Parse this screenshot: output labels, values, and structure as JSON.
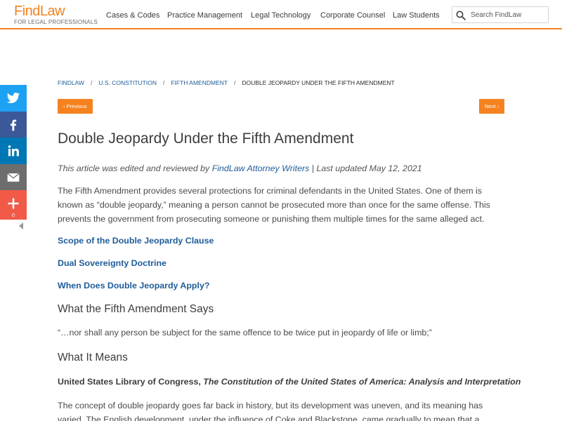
{
  "header": {
    "logo": {
      "name": "FindLaw",
      "tagline": "FOR LEGAL PROFESSIONALS"
    },
    "nav": [
      {
        "label": "Cases & Codes"
      },
      {
        "label": "Practice Management"
      },
      {
        "label": "Legal Technology"
      },
      {
        "label": "Corporate Counsel"
      },
      {
        "label": "Law Students"
      }
    ],
    "search": {
      "placeholder": "Search FindLaw"
    },
    "accent_color": "#f5821f"
  },
  "social": {
    "buttons": [
      {
        "icon": "twitter-icon",
        "color": "#1da1f2"
      },
      {
        "icon": "facebook-icon",
        "color": "#3b5998"
      },
      {
        "icon": "linkedin-icon",
        "color": "#0077b5"
      },
      {
        "icon": "email-icon",
        "color": "#6d6d6d"
      },
      {
        "icon": "plus-icon",
        "color": "#f05a47"
      }
    ],
    "share_count": "0"
  },
  "breadcrumb": {
    "items": [
      "FINDLAW",
      "U.S. CONSTITUTION",
      "FIFTH AMENDMENT"
    ],
    "current": "DOUBLE JEOPARDY UNDER THE FIFTH AMENDMENT"
  },
  "pager": {
    "prev": "‹ Previous",
    "next": "Next ›"
  },
  "article": {
    "title": "Double Jeopardy Under the Fifth Amendment",
    "byline_prefix": "This article was edited and reviewed by ",
    "byline_author": "FindLaw Attorney Writers",
    "byline_suffix": " | Last updated May 12, 2021",
    "intro": "The Fifth Amendment provides several protections for criminal defendants in the United States. One of them is known as “double jeopardy,” meaning a person cannot be prosecuted more than once for the same offense. This prevents the government from prosecuting someone or punishing them multiple times for the same alleged act.",
    "toc": [
      "Scope of the Double Jeopardy Clause",
      "Dual Sovereignty Doctrine",
      "When Does Double Jeopardy Apply?"
    ],
    "h2_says": "What the Fifth Amendment Says",
    "quote": "“…nor shall any person be subject for the same offence to be twice put in jeopardy of life or limb;”",
    "h2_means": "What It Means",
    "source_org": "United States Library of Congress, ",
    "source_title": "The Constitution of the United States of America: Analysis and Interpretation",
    "para2": "The concept of double jeopardy goes far back in history, but its development was uneven, and its meaning has varied. The English development, under the influence of Coke and Blackstone, came gradually to mean that a"
  }
}
